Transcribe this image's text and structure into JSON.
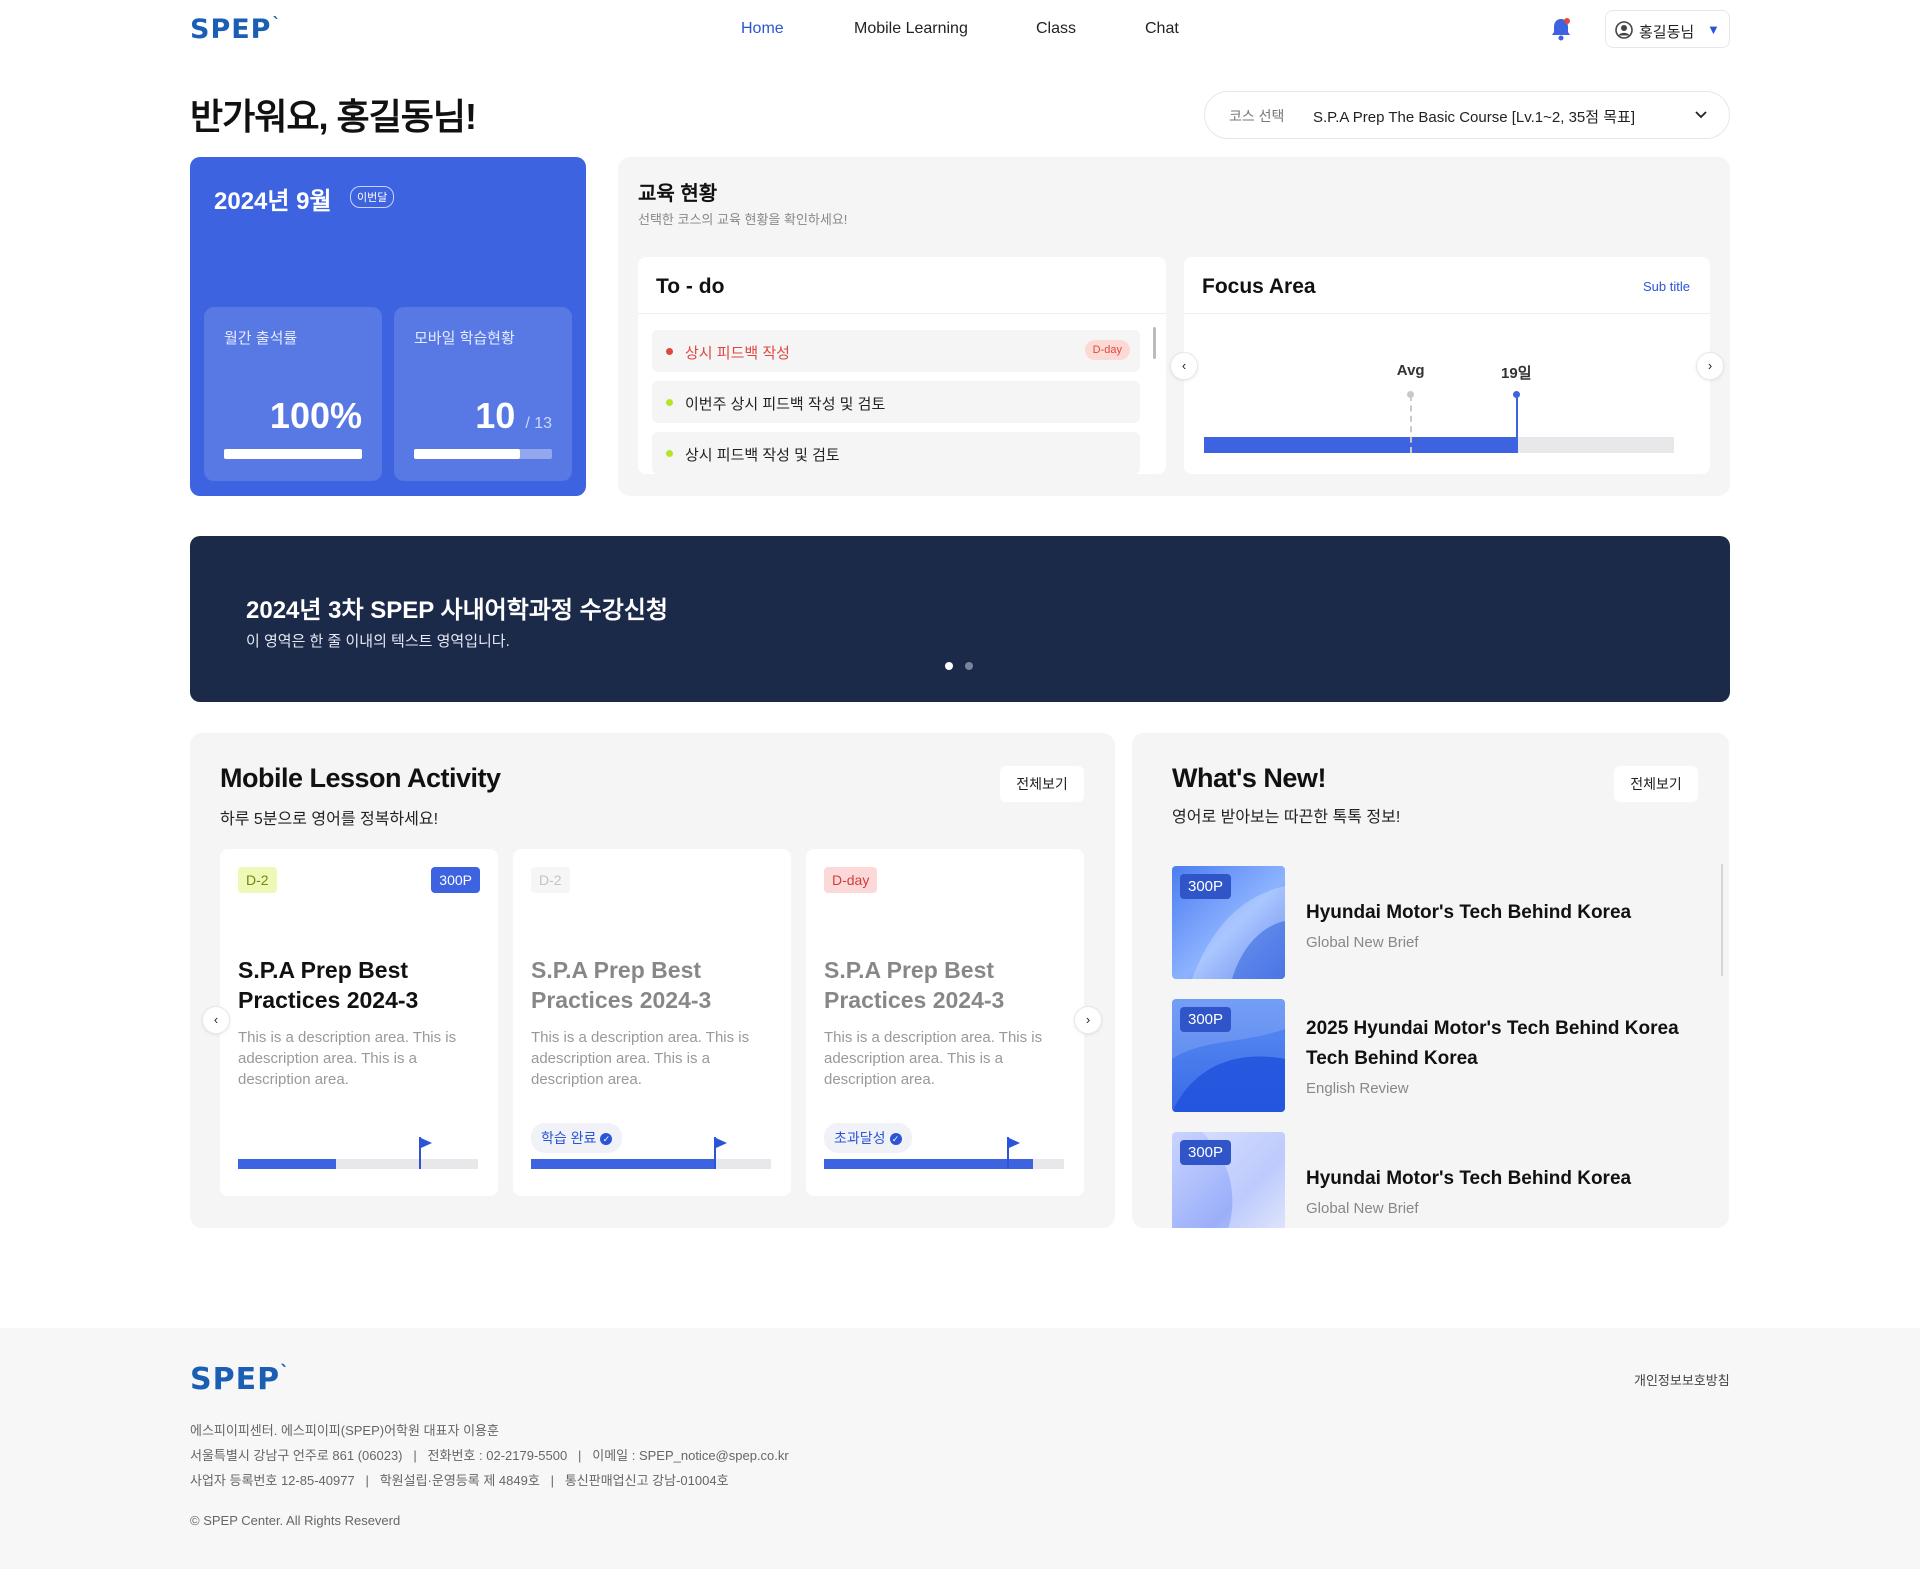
{
  "header": {
    "logo": "SPEP",
    "logo_tick": "`",
    "nav": [
      "Home",
      "Mobile Learning",
      "Class",
      "Chat"
    ],
    "active_nav": "Home",
    "user_name": "홍길동님"
  },
  "greeting": "반가워요, 홍길동님!",
  "course_select": {
    "label": "코스 선택",
    "value": "S.P.A Prep The Basic Course [Lv.1~2, 35점 목표]"
  },
  "month_card": {
    "title": "2024년 9월",
    "badge": "이번달",
    "attendance_label": "월간 출석률",
    "attendance_value": "100%",
    "attendance_progress": 1.0,
    "mobile_label": "모바일 학습현황",
    "mobile_value": "10",
    "mobile_total": "/ 13",
    "mobile_progress": 0.77
  },
  "edu_status": {
    "title": "교육 현황",
    "subtitle": "선택한 코스의 교육 현황을 확인하세요!",
    "todo_title": "To - do",
    "todo_items": [
      {
        "text": "상시 피드백 작성",
        "badge": "D-day",
        "color": "#e0483e"
      },
      {
        "text": "이번주 상시 피드백 작성 및 검토",
        "badge": "",
        "color": "#b5e42a"
      },
      {
        "text": "상시 피드백 작성 및 검토",
        "badge": "",
        "color": "#b5e42a"
      }
    ],
    "focus_title": "Focus Area",
    "focus_subtitle": "Sub title",
    "focus_avg_label": "Avg",
    "focus_value_label": "19일",
    "focus_avg_fraction": 0.44,
    "focus_value_fraction": 0.665
  },
  "banner": {
    "title": "2024년 3차 SPEP 사내어학과정 수강신청",
    "subtitle": "이 영역은 한 줄 이내의 텍스트 영역입니다.",
    "slides": 2,
    "active_slide": 1
  },
  "mobile_lesson": {
    "title": "Mobile Lesson Activity",
    "subtitle": "하루 5분으로 영어를 정복하세요!",
    "view_all": "전체보기",
    "lessons": [
      {
        "tag": "D-2",
        "points": "300P",
        "title": "S.P.A Prep Best Practices 2024-3",
        "desc": "This is a description area. This is adescription area. This is a description area.",
        "chip": "",
        "progress": 0.41
      },
      {
        "tag": "D-2",
        "points": "",
        "title": "S.P.A Prep Best Practices 2024-3",
        "desc": "This is a description area. This is adescription area. This is a description area.",
        "chip": "학습 완료",
        "progress": 0.77
      },
      {
        "tag": "D-day",
        "points": "",
        "title": "S.P.A Prep Best Practices 2024-3",
        "desc": "This is a description area. This is adescription area. This is a description area.",
        "chip": "초과달성",
        "progress": 0.87
      }
    ]
  },
  "whats_new": {
    "title": "What's New!",
    "subtitle": "영어로 받아보는 따끈한 톡톡 정보!",
    "view_all": "전체보기",
    "items": [
      {
        "points": "300P",
        "title": "Hyundai Motor's Tech Behind Korea",
        "title2": "",
        "sub": "Global New Brief"
      },
      {
        "points": "300P",
        "title": "2025 Hyundai Motor's Tech Behind Korea",
        "title2": "Tech Behind Korea",
        "sub": "English Review"
      },
      {
        "points": "300P",
        "title": "Hyundai Motor's Tech Behind Korea",
        "title2": "",
        "sub": "Global New Brief"
      }
    ]
  },
  "footer": {
    "logo": "SPEP",
    "policy": "개인정보보호방침",
    "line1": "에스피이피센터. 에스피이피(SPEP)어학원 대표자 이용훈",
    "line2": "서울특별시 강남구 언주로 861 (06023)   |   전화번호 : 02-2179-5500   |   이메일 : SPEP_notice@spep.co.kr",
    "line3": "사업자 등록번호 12-85-40977   |   학원설립·운영등록 제 4849호   |   통신판매업신고 강남-01004호",
    "copyright": "© SPEP Center. All Rights Reseverd"
  },
  "colors": {
    "brand": "#1a5fb4",
    "accent": "#3d63e0",
    "banner": "#1c2a4a",
    "danger": "#e0483e",
    "lime": "#b5e42a"
  }
}
